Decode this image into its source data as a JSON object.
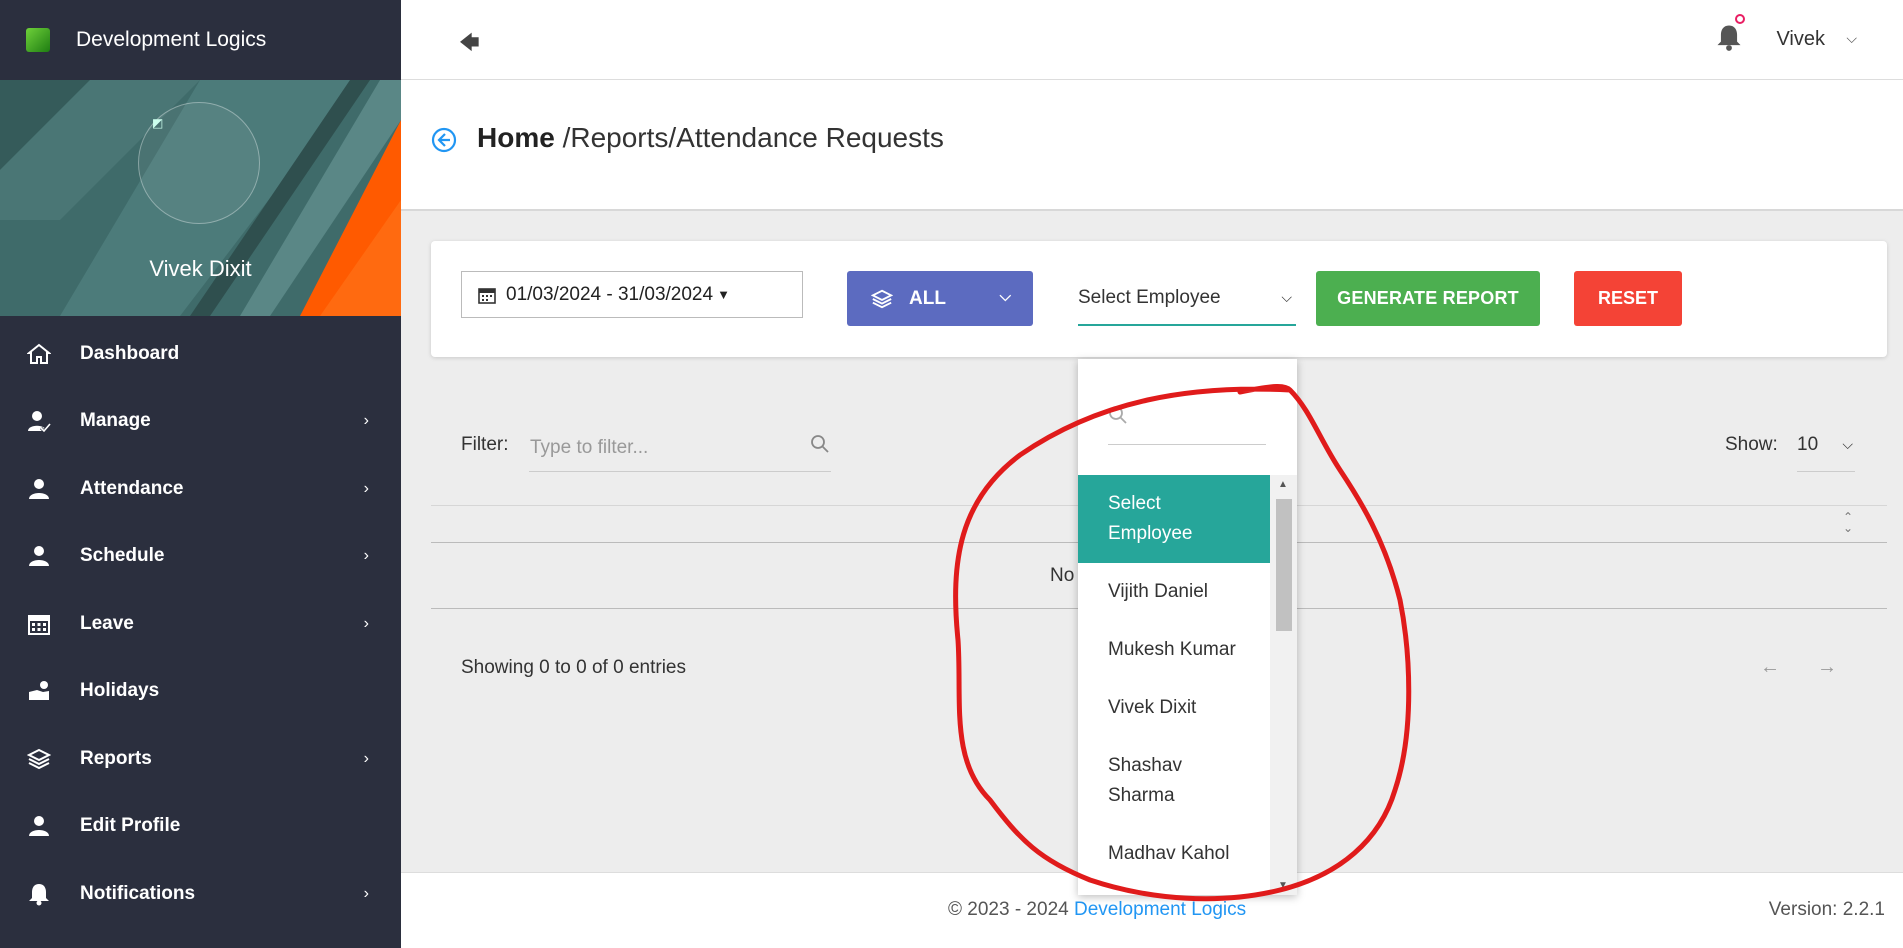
{
  "brand": {
    "name": "Development Logics",
    "logo_icon": "brand-logo-icon"
  },
  "profile": {
    "name": "Vivek Dixit"
  },
  "sidebar": {
    "items": [
      {
        "label": "Dashboard",
        "icon": "home-icon",
        "has_submenu": false
      },
      {
        "label": "Manage",
        "icon": "user-check-icon",
        "has_submenu": true
      },
      {
        "label": "Attendance",
        "icon": "user-icon",
        "has_submenu": true
      },
      {
        "label": "Schedule",
        "icon": "user-icon",
        "has_submenu": true
      },
      {
        "label": "Leave",
        "icon": "calendar-icon",
        "has_submenu": true
      },
      {
        "label": "Holidays",
        "icon": "holiday-icon",
        "has_submenu": false
      },
      {
        "label": "Reports",
        "icon": "layers-icon",
        "has_submenu": true
      },
      {
        "label": "Edit Profile",
        "icon": "user-icon",
        "has_submenu": false
      },
      {
        "label": "Notifications",
        "icon": "bell-icon",
        "has_submenu": true
      }
    ]
  },
  "topbar": {
    "user_name": "Vivek"
  },
  "header": {
    "home": "Home",
    "path": " /Reports/Attendance Requests"
  },
  "filters": {
    "date_range": "01/03/2024 - 31/03/2024",
    "type_label": "ALL",
    "employee_placeholder": "Select Employee",
    "generate_label": "GENERATE REPORT",
    "reset_label": "RESET"
  },
  "table": {
    "filter_label": "Filter:",
    "filter_placeholder": "Type to filter...",
    "show_label": "Show:",
    "page_size": "10",
    "empty_text": "No",
    "showing_text": "Showing 0 to 0 of 0 entries",
    "prev": "←",
    "next": "→"
  },
  "dropdown": {
    "options": [
      "Select Employee",
      "Vijith  Daniel",
      "Mukesh Kumar",
      "Vivek  Dixit",
      "Shashav Sharma",
      "Madhav  Kahol"
    ],
    "selected_index": 0
  },
  "footer": {
    "copyright_prefix": "© 2023 - 2024 ",
    "copyright_link": "Development Logics",
    "version": "Version: 2.2.1"
  },
  "colors": {
    "sidebar_bg": "#2b2f3e",
    "accent_teal": "#26a69a",
    "all_button": "#5c6bc0",
    "generate_button": "#4caf50",
    "reset_button": "#f44336",
    "link": "#2196f3",
    "annotation": "#e01b1b"
  }
}
